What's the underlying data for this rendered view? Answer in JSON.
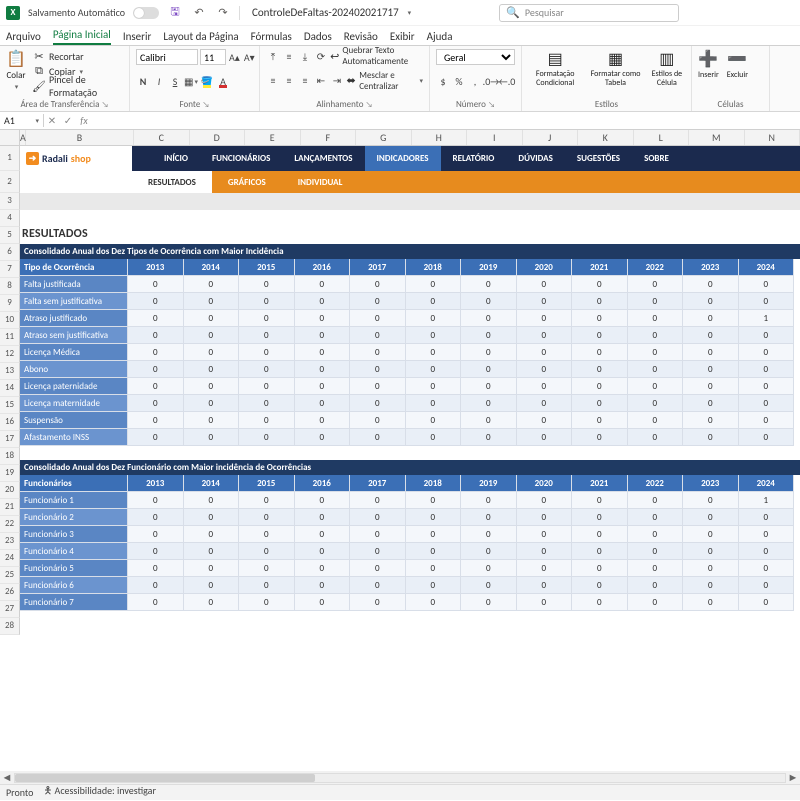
{
  "titlebar": {
    "autosave": "Salvamento Automático",
    "filename": "ControleDeFaltas-202402021717",
    "search_placeholder": "Pesquisar"
  },
  "menu": {
    "tabs": [
      "Arquivo",
      "Página Inicial",
      "Inserir",
      "Layout da Página",
      "Fórmulas",
      "Dados",
      "Revisão",
      "Exibir",
      "Ajuda"
    ],
    "active": 1
  },
  "ribbon": {
    "clipboard": {
      "paste": "Colar",
      "cut": "Recortar",
      "copy": "Copiar",
      "painter": "Pincel de Formatação",
      "label": "Área de Transferência"
    },
    "font": {
      "name": "Calibri",
      "size": "11",
      "label": "Fonte",
      "bold": "N",
      "italic": "I",
      "underline": "S"
    },
    "align": {
      "wrap": "Quebrar Texto Automaticamente",
      "merge": "Mesclar e Centralizar",
      "label": "Alinhamento"
    },
    "number": {
      "general": "Geral",
      "label": "Número"
    },
    "styles": {
      "cond": "Formatação Condicional",
      "table": "Formatar como Tabela",
      "cell": "Estilos de Célula",
      "label": "Estilos"
    },
    "cells": {
      "insert": "Inserir",
      "delete": "Excluir",
      "label": "Células"
    }
  },
  "namebox": "A1",
  "columns": [
    "A",
    "B",
    "C",
    "D",
    "E",
    "F",
    "G",
    "H",
    "I",
    "J",
    "K",
    "L",
    "M",
    "N"
  ],
  "rows": [
    "1",
    "2",
    "3",
    "4",
    "5",
    "6",
    "7",
    "8",
    "9",
    "10",
    "11",
    "12",
    "13",
    "14",
    "15",
    "16",
    "17",
    "18",
    "19",
    "20",
    "21",
    "22",
    "23",
    "24",
    "25",
    "26",
    "27",
    "28"
  ],
  "dashboard": {
    "logo1": "Radali",
    "logo2": "shop",
    "nav": [
      "INÍCIO",
      "FUNCIONÁRIOS",
      "LANÇAMENTOS",
      "INDICADORES",
      "RELATÓRIO",
      "DÚVIDAS",
      "SUGESTÕES",
      "SOBRE"
    ],
    "nav_active": 3,
    "subnav": [
      "RESULTADOS",
      "GRÁFICOS",
      "INDIVIDUAL"
    ],
    "subnav_active": 0
  },
  "section_title": "RESULTADOS",
  "table1": {
    "title": "Consolidado Anual dos Dez Tipos de Ocorrência com Maior Incidência",
    "head_first": "Tipo de Ocorrência",
    "years": [
      "2013",
      "2014",
      "2015",
      "2016",
      "2017",
      "2018",
      "2019",
      "2020",
      "2021",
      "2022",
      "2023",
      "2024"
    ],
    "rows": [
      {
        "label": "Falta justificada",
        "v": [
          "0",
          "0",
          "0",
          "0",
          "0",
          "0",
          "0",
          "0",
          "0",
          "0",
          "0",
          "0"
        ]
      },
      {
        "label": "Falta sem justificativa",
        "v": [
          "0",
          "0",
          "0",
          "0",
          "0",
          "0",
          "0",
          "0",
          "0",
          "0",
          "0",
          "0"
        ]
      },
      {
        "label": "Atraso justificado",
        "v": [
          "0",
          "0",
          "0",
          "0",
          "0",
          "0",
          "0",
          "0",
          "0",
          "0",
          "0",
          "1"
        ]
      },
      {
        "label": "Atraso sem justificativa",
        "v": [
          "0",
          "0",
          "0",
          "0",
          "0",
          "0",
          "0",
          "0",
          "0",
          "0",
          "0",
          "0"
        ]
      },
      {
        "label": "Licença Médica",
        "v": [
          "0",
          "0",
          "0",
          "0",
          "0",
          "0",
          "0",
          "0",
          "0",
          "0",
          "0",
          "0"
        ]
      },
      {
        "label": "Abono",
        "v": [
          "0",
          "0",
          "0",
          "0",
          "0",
          "0",
          "0",
          "0",
          "0",
          "0",
          "0",
          "0"
        ]
      },
      {
        "label": "Licença paternidade",
        "v": [
          "0",
          "0",
          "0",
          "0",
          "0",
          "0",
          "0",
          "0",
          "0",
          "0",
          "0",
          "0"
        ]
      },
      {
        "label": "Licença maternidade",
        "v": [
          "0",
          "0",
          "0",
          "0",
          "0",
          "0",
          "0",
          "0",
          "0",
          "0",
          "0",
          "0"
        ]
      },
      {
        "label": "Suspensão",
        "v": [
          "0",
          "0",
          "0",
          "0",
          "0",
          "0",
          "0",
          "0",
          "0",
          "0",
          "0",
          "0"
        ]
      },
      {
        "label": "Afastamento INSS",
        "v": [
          "0",
          "0",
          "0",
          "0",
          "0",
          "0",
          "0",
          "0",
          "0",
          "0",
          "0",
          "0"
        ]
      }
    ]
  },
  "table2": {
    "title": "Consolidado Anual dos Dez Funcionário com Maior incidência de Ocorrências",
    "head_first": "Funcionários",
    "years": [
      "2013",
      "2014",
      "2015",
      "2016",
      "2017",
      "2018",
      "2019",
      "2020",
      "2021",
      "2022",
      "2023",
      "2024"
    ],
    "rows": [
      {
        "label": "Funcionário 1",
        "v": [
          "0",
          "0",
          "0",
          "0",
          "0",
          "0",
          "0",
          "0",
          "0",
          "0",
          "0",
          "1"
        ]
      },
      {
        "label": "Funcionário 2",
        "v": [
          "0",
          "0",
          "0",
          "0",
          "0",
          "0",
          "0",
          "0",
          "0",
          "0",
          "0",
          "0"
        ]
      },
      {
        "label": "Funcionário 3",
        "v": [
          "0",
          "0",
          "0",
          "0",
          "0",
          "0",
          "0",
          "0",
          "0",
          "0",
          "0",
          "0"
        ]
      },
      {
        "label": "Funcionário 4",
        "v": [
          "0",
          "0",
          "0",
          "0",
          "0",
          "0",
          "0",
          "0",
          "0",
          "0",
          "0",
          "0"
        ]
      },
      {
        "label": "Funcionário 5",
        "v": [
          "0",
          "0",
          "0",
          "0",
          "0",
          "0",
          "0",
          "0",
          "0",
          "0",
          "0",
          "0"
        ]
      },
      {
        "label": "Funcionário 6",
        "v": [
          "0",
          "0",
          "0",
          "0",
          "0",
          "0",
          "0",
          "0",
          "0",
          "0",
          "0",
          "0"
        ]
      },
      {
        "label": "Funcionário 7",
        "v": [
          "0",
          "0",
          "0",
          "0",
          "0",
          "0",
          "0",
          "0",
          "0",
          "0",
          "0",
          "0"
        ]
      }
    ]
  },
  "status": {
    "ready": "Pronto",
    "a11y": "Acessibilidade: investigar"
  }
}
